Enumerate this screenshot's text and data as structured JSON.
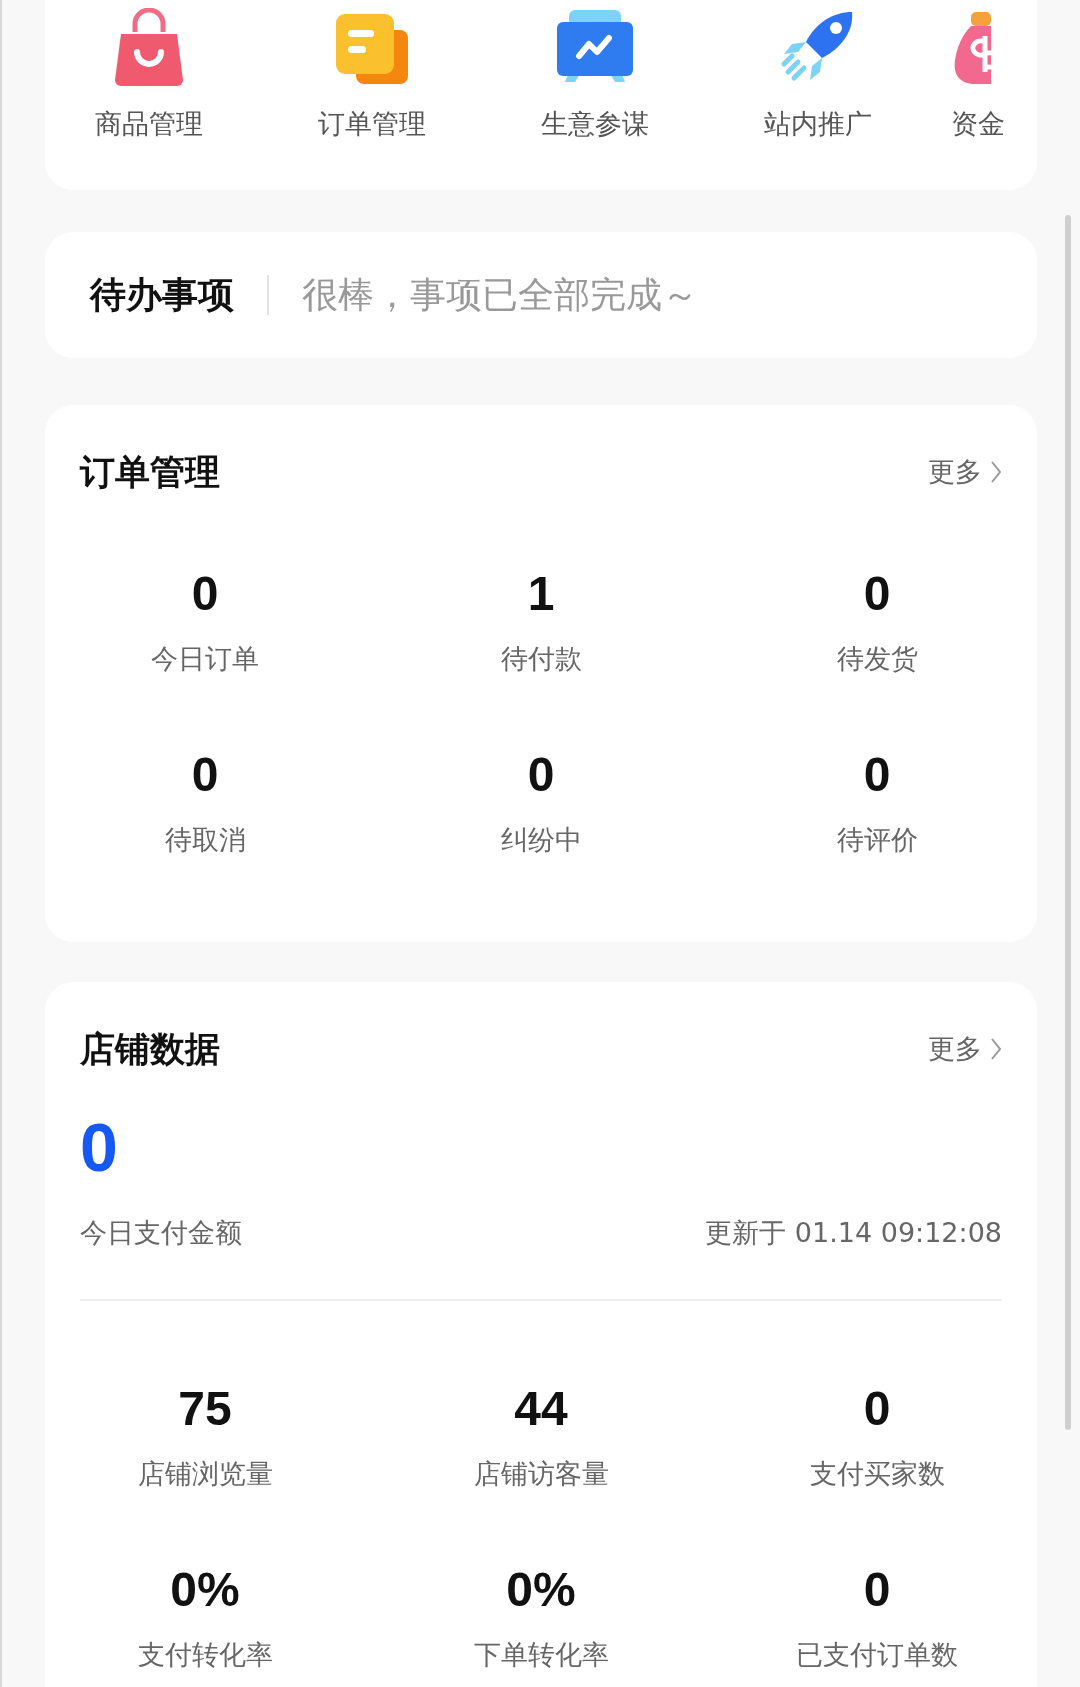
{
  "shortcuts": [
    {
      "kind": "bag",
      "label": "商品管理"
    },
    {
      "kind": "document",
      "label": "订单管理"
    },
    {
      "kind": "chart",
      "label": "生意参谋"
    },
    {
      "kind": "rocket",
      "label": "站内推广"
    },
    {
      "kind": "money",
      "label": "资金"
    }
  ],
  "todo": {
    "title": "待办事项",
    "message": "很棒，事项已全部完成～"
  },
  "orders": {
    "title": "订单管理",
    "more": "更多",
    "stats": [
      {
        "value": "0",
        "label": "今日订单"
      },
      {
        "value": "1",
        "label": "待付款"
      },
      {
        "value": "0",
        "label": "待发货"
      },
      {
        "value": "0",
        "label": "待取消"
      },
      {
        "value": "0",
        "label": "纠纷中"
      },
      {
        "value": "0",
        "label": "待评价"
      }
    ]
  },
  "store": {
    "title": "店铺数据",
    "more": "更多",
    "amount": "0",
    "amount_label": "今日支付金额",
    "updated": "更新于 01.14 09:12:08",
    "stats": [
      {
        "value": "75",
        "label": "店铺浏览量"
      },
      {
        "value": "44",
        "label": "店铺访客量"
      },
      {
        "value": "0",
        "label": "支付买家数"
      },
      {
        "value": "0%",
        "label": "支付转化率"
      },
      {
        "value": "0%",
        "label": "下单转化率"
      },
      {
        "value": "0",
        "label": "已支付订单数"
      }
    ]
  }
}
